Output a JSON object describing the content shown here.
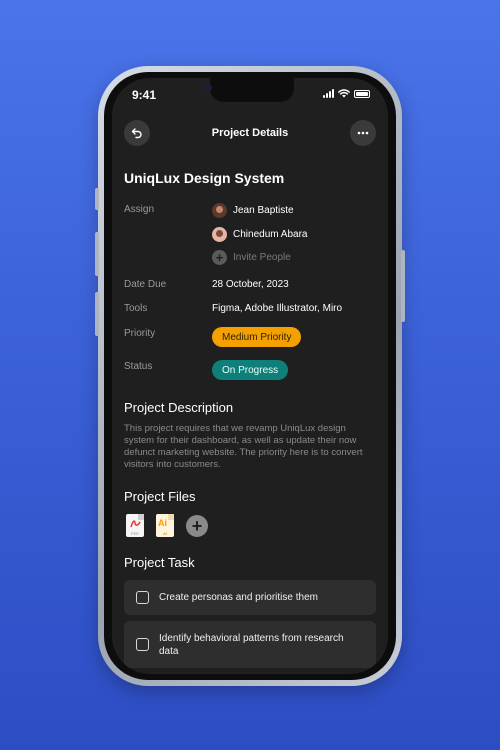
{
  "status_bar": {
    "time": "9:41"
  },
  "header": {
    "title": "Project Details",
    "back_icon": "back-arrow-icon",
    "more_icon": "more-dots-icon"
  },
  "project": {
    "title": "UniqLux Design System",
    "assign_label": "Assign",
    "assignees": [
      {
        "name": "Jean Baptiste"
      },
      {
        "name": "Chinedum Abara"
      }
    ],
    "invite_label": "Invite People",
    "date_due_label": "Date Due",
    "date_due": "28 October, 2023",
    "tools_label": "Tools",
    "tools": "Figma, Adobe Illustrator, Miro",
    "priority_label": "Priority",
    "priority": "Medium Priority",
    "status_label": "Status",
    "status": "On Progress"
  },
  "description": {
    "title": "Project Description",
    "text": "This project requires that we revamp UniqLux design system for their dashboard, as well as update their now defunct marketing website. The priority here is to convert visitors into customers."
  },
  "files": {
    "title": "Project Files",
    "items": [
      {
        "type": "PDF",
        "icon": "pdf-file-icon"
      },
      {
        "type": "Ai",
        "sub": "AI",
        "icon": "illustrator-file-icon"
      }
    ]
  },
  "tasks": {
    "title": "Project Task",
    "items": [
      {
        "text": "Create personas and prioritise them"
      },
      {
        "text": "Identify behavioral patterns from research data"
      }
    ]
  },
  "colors": {
    "background": "#3a5fd6",
    "screen": "#1f1f1f",
    "priority": "#f4a100",
    "status": "#0e7f79"
  }
}
